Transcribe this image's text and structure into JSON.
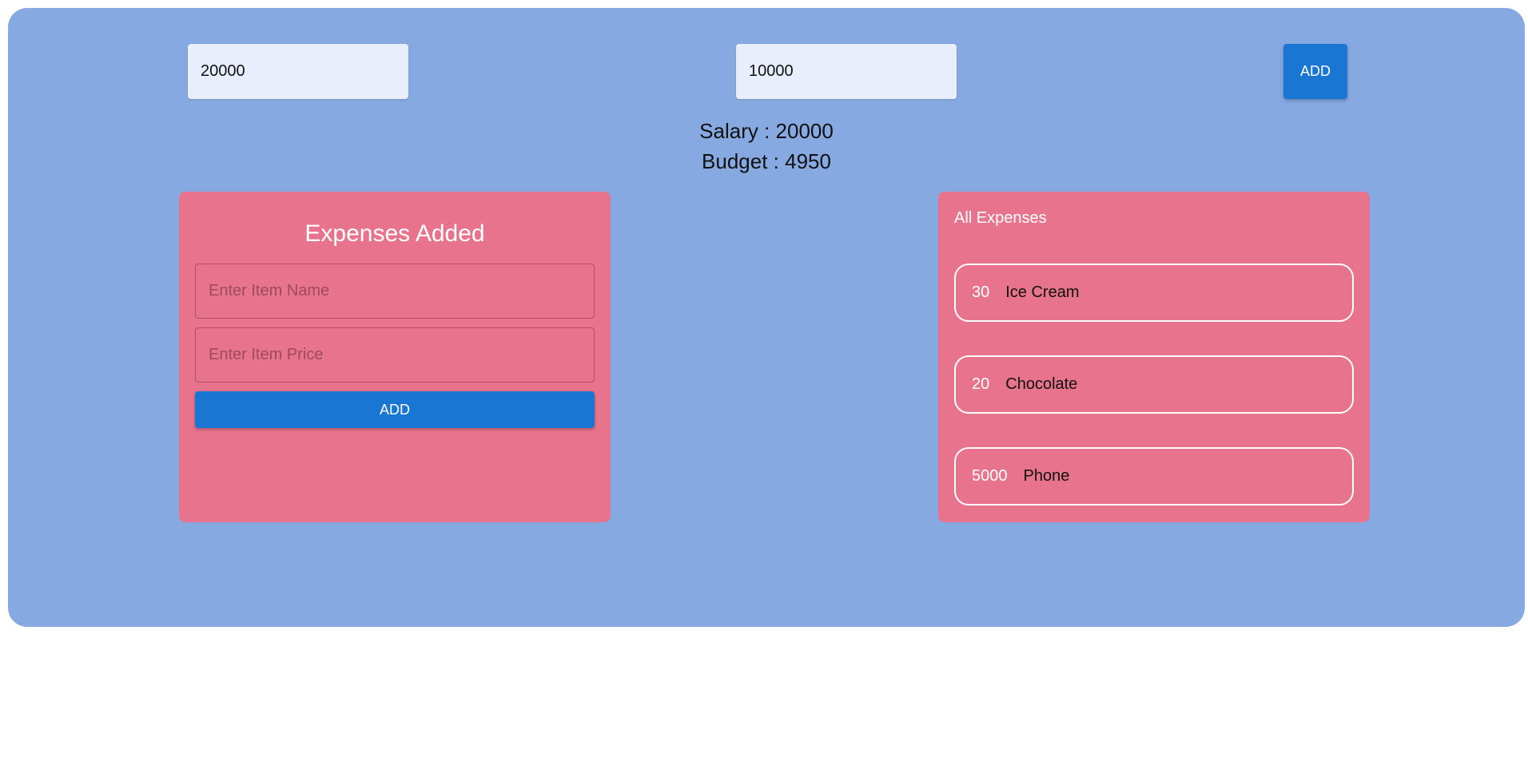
{
  "top": {
    "salary_value": "20000",
    "budget_value": "10000",
    "add_label": "ADD"
  },
  "summary": {
    "salary_text": "Salary : 20000",
    "budget_text": "Budget : 4950"
  },
  "form": {
    "title": "Expenses Added",
    "item_name_placeholder": "Enter Item Name",
    "item_price_placeholder": "Enter Item Price",
    "add_label": "ADD"
  },
  "expenses": {
    "title": "All Expenses",
    "items": [
      {
        "price": "30",
        "name": "Ice Cream"
      },
      {
        "price": "20",
        "name": "Chocolate"
      },
      {
        "price": "5000",
        "name": "Phone"
      }
    ]
  },
  "colors": {
    "background": "#87a9e1",
    "panel": "#e8738c",
    "accent": "#1976d2"
  }
}
